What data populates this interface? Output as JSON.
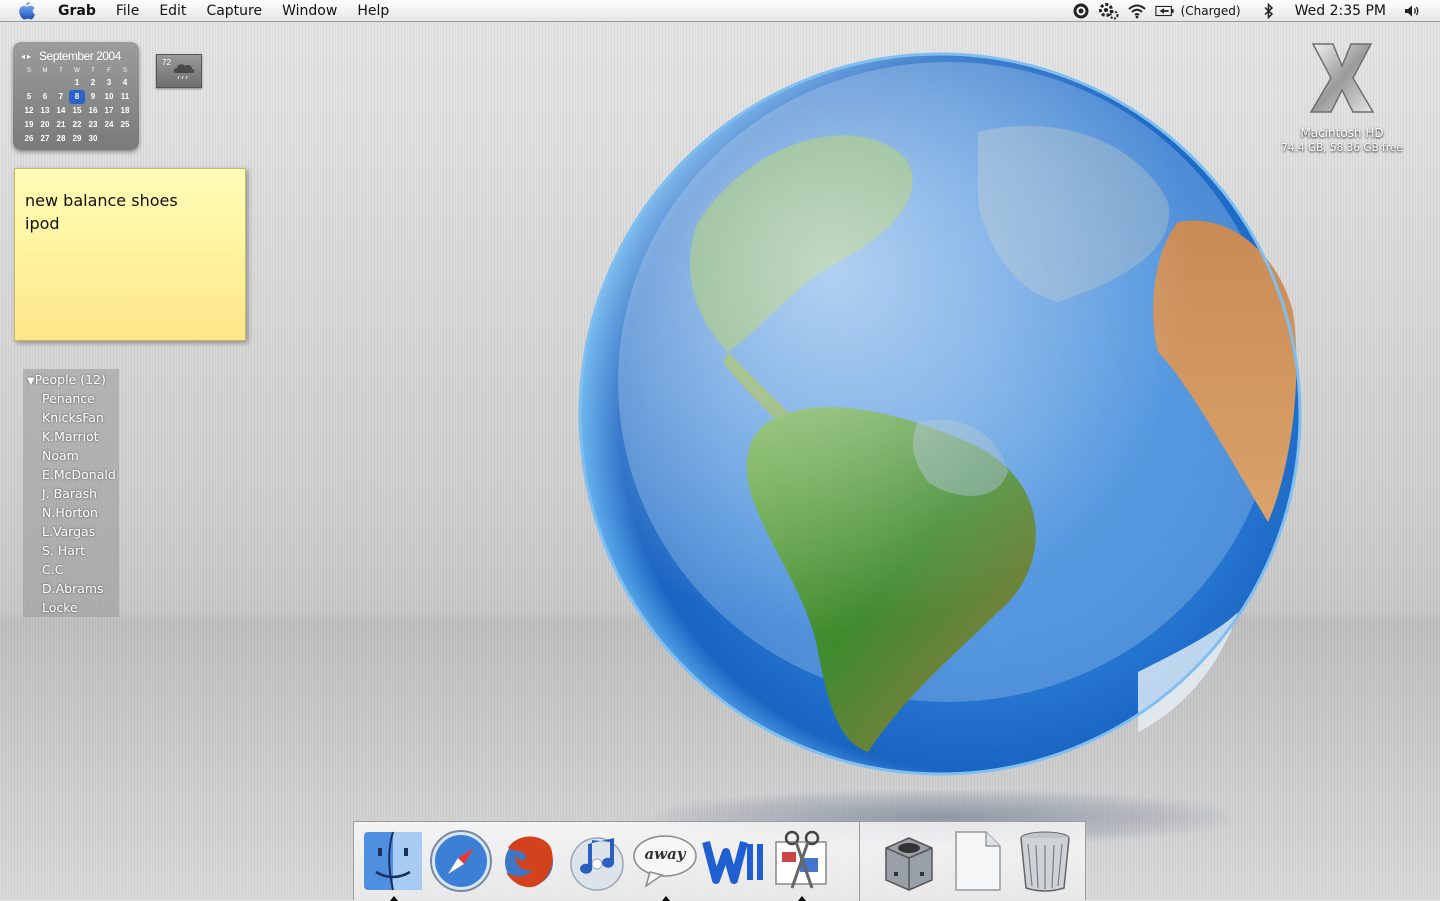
{
  "menubar": {
    "app_name": "Grab",
    "menus": [
      "File",
      "Edit",
      "Capture",
      "Window",
      "Help"
    ],
    "battery_status": "(Charged)",
    "clock": "Wed 2:35 PM",
    "icons": [
      "apple-icon",
      "ichat-status-icon",
      "script-menu-icon",
      "wifi-icon",
      "battery-icon",
      "bluetooth-icon",
      "volume-icon"
    ]
  },
  "calendar_widget": {
    "month": "September 2004",
    "weekdays": [
      "S",
      "M",
      "T",
      "W",
      "T",
      "F",
      "S"
    ],
    "weeks": [
      [
        "",
        "",
        "",
        "1",
        "2",
        "3",
        "4"
      ],
      [
        "5",
        "6",
        "7",
        "8",
        "9",
        "10",
        "11"
      ],
      [
        "12",
        "13",
        "14",
        "15",
        "16",
        "17",
        "18"
      ],
      [
        "19",
        "20",
        "21",
        "22",
        "23",
        "24",
        "25"
      ],
      [
        "26",
        "27",
        "28",
        "29",
        "30",
        "",
        ""
      ]
    ],
    "today": "8",
    "accent": "#2b63c8"
  },
  "weather_widget": {
    "temperature": "72",
    "condition_icon": "rain-cloud-icon"
  },
  "stickies_note": {
    "lines": [
      "new balance shoes",
      "ipod"
    ]
  },
  "buddy_list": {
    "group_label": "People (12)",
    "buddies": [
      "Penance",
      "KnicksFan",
      "K.Marriot",
      "Noam",
      "E.McDonald",
      "J. Barash",
      "N.Horton",
      "L.Vargas",
      "S. Hart",
      "C.C",
      "D.Abrams",
      "Locke"
    ]
  },
  "desktop": {
    "drive_name": "Macintosh HD",
    "drive_info": "74.4 GB, 58.36 GB free",
    "drive_icon": "mac-os-x-drive-icon",
    "wallpaper": "earth-globe"
  },
  "dock": {
    "apps": [
      {
        "name": "finder",
        "icon": "finder-icon",
        "running": true
      },
      {
        "name": "safari",
        "icon": "safari-compass-icon",
        "running": false
      },
      {
        "name": "firefox",
        "icon": "firefox-icon",
        "running": false
      },
      {
        "name": "itunes",
        "icon": "itunes-icon",
        "running": false
      },
      {
        "name": "away",
        "icon": "away-bubble-icon",
        "running": true,
        "label": "away"
      },
      {
        "name": "word",
        "icon": "word-w-icon",
        "running": false
      },
      {
        "name": "grab",
        "icon": "grab-scissors-icon",
        "running": true
      }
    ],
    "others": [
      {
        "name": "gamecube",
        "icon": "gamecube-icon"
      },
      {
        "name": "document",
        "icon": "blank-document-icon"
      },
      {
        "name": "trash",
        "icon": "trash-icon"
      }
    ]
  }
}
